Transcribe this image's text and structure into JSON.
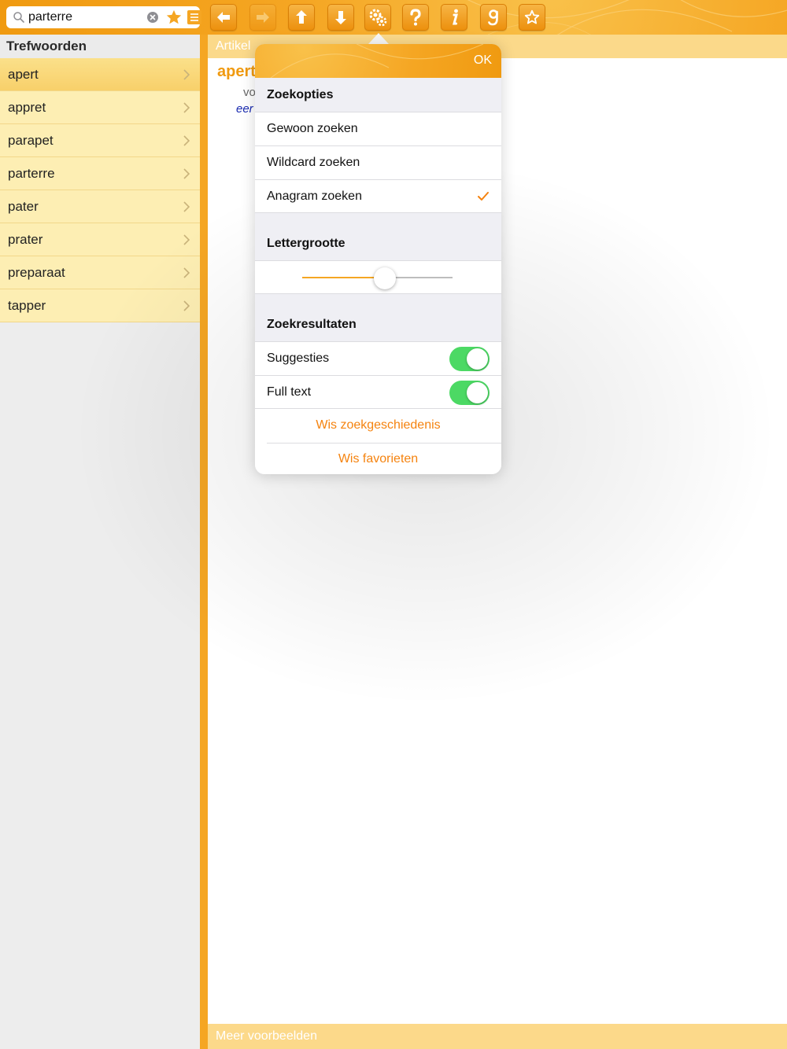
{
  "colors": {
    "accent": "#f5a623",
    "action_text": "#f5830f",
    "toggle_on": "#4cd964",
    "list_bg": "#fdeeb3",
    "definition_blue": "#1a2bb0"
  },
  "search": {
    "value": "parterre",
    "icon": "search-icon",
    "clear_icon": "clear-icon",
    "favorite_icon": "star-icon",
    "list_icon": "list-icon"
  },
  "toolbar": {
    "buttons": [
      {
        "icon": "arrow-left-icon",
        "enabled": true
      },
      {
        "icon": "arrow-right-icon",
        "enabled": false
      },
      {
        "icon": "arrow-up-icon",
        "enabled": true
      },
      {
        "icon": "arrow-down-icon",
        "enabled": true
      },
      {
        "icon": "gears-icon",
        "enabled": true
      },
      {
        "icon": "question-icon",
        "enabled": true
      },
      {
        "icon": "info-icon",
        "enabled": true
      },
      {
        "icon": "google-g-icon",
        "enabled": true
      },
      {
        "icon": "star-outline-icon",
        "enabled": true
      }
    ]
  },
  "sidebar": {
    "title": "Trefwoorden",
    "items": [
      {
        "label": "apert",
        "selected": true
      },
      {
        "label": "appret",
        "selected": false
      },
      {
        "label": "parapet",
        "selected": false
      },
      {
        "label": "parterre",
        "selected": false
      },
      {
        "label": "pater",
        "selected": false
      },
      {
        "label": "prater",
        "selected": false
      },
      {
        "label": "preparaat",
        "selected": false
      },
      {
        "label": "tapper",
        "selected": false
      }
    ]
  },
  "article": {
    "header": "Artikel",
    "word": "apert",
    "pos_partial": "vo",
    "def_partial": "eer",
    "footer": "Meer voorbeelden"
  },
  "popover": {
    "ok_label": "OK",
    "search_options": {
      "title": "Zoekopties",
      "options": [
        {
          "label": "Gewoon zoeken",
          "checked": false
        },
        {
          "label": "Wildcard zoeken",
          "checked": false
        },
        {
          "label": "Anagram zoeken",
          "checked": true
        }
      ]
    },
    "font_size": {
      "title": "Lettergrootte",
      "level": 0.55
    },
    "results": {
      "title": "Zoekresultaten",
      "toggles": [
        {
          "label": "Suggesties",
          "on": true
        },
        {
          "label": "Full text",
          "on": true
        }
      ],
      "clear_history_label": "Wis zoekgeschiedenis",
      "clear_favorites_label": "Wis favorieten"
    }
  }
}
